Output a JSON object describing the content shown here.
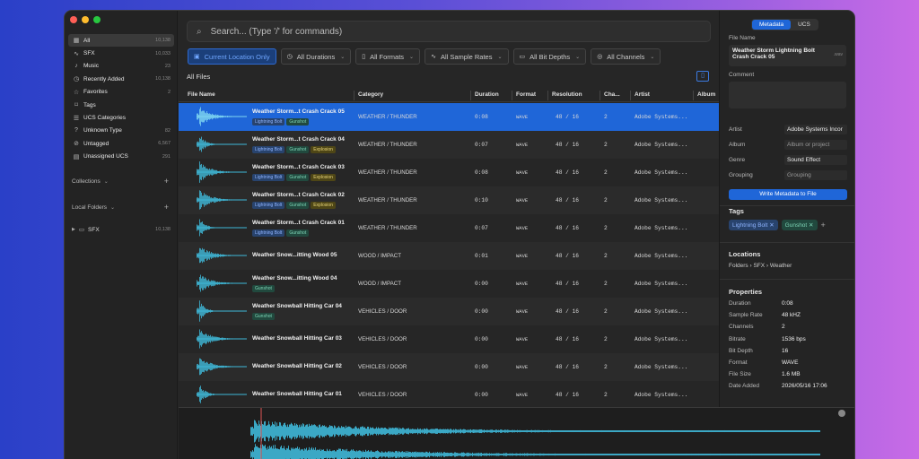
{
  "colors": {
    "accent": "#1f66d8",
    "waveform": "#3fb8d8"
  },
  "sidebar": {
    "items": [
      {
        "icon": "grid-icon",
        "label": "All",
        "count": "10,138",
        "active": true
      },
      {
        "icon": "waveform-icon",
        "label": "SFX",
        "count": "10,033"
      },
      {
        "icon": "music-note-icon",
        "label": "Music",
        "count": "23"
      },
      {
        "icon": "clock-icon",
        "label": "Recently Added",
        "count": "10,138"
      },
      {
        "icon": "star-icon",
        "label": "Favorites",
        "count": "2"
      },
      {
        "icon": "tag-icon",
        "label": "Tags",
        "count": ""
      },
      {
        "icon": "list-icon",
        "label": "UCS Categories",
        "count": ""
      },
      {
        "icon": "question-icon",
        "label": "Unknown Type",
        "count": "82"
      },
      {
        "icon": "untagged-icon",
        "label": "Untagged",
        "count": "6,567"
      },
      {
        "icon": "unassigned-icon",
        "label": "Unassigned UCS",
        "count": "291"
      }
    ],
    "collections_label": "Collections",
    "local_folders_label": "Local Folders",
    "folder": {
      "name": "SFX",
      "count": "10,138"
    }
  },
  "search": {
    "placeholder": "Search... (Type '/' for commands)"
  },
  "filters": [
    {
      "label": "Current Location Only",
      "active": true
    },
    {
      "label": "All Durations"
    },
    {
      "label": "All Formats"
    },
    {
      "label": "All Sample Rates"
    },
    {
      "label": "All Bit Depths"
    },
    {
      "label": "All Channels"
    }
  ],
  "list": {
    "title": "All Files",
    "columns": [
      "File Name",
      "Category",
      "Duration",
      "Format",
      "Resolution",
      "Cha...",
      "Artist",
      "Album"
    ],
    "rows": [
      {
        "name": "Weather Storm...t Crash Crack 05",
        "tags": [
          [
            "Lightning Bolt",
            "blue"
          ],
          [
            "Gunshot",
            "green"
          ]
        ],
        "category": "WEATHER / THUNDER",
        "duration": "0:08",
        "format": "WAVE",
        "resolution": "48 / 16",
        "channels": "2",
        "artist": "Adobe Systems..."
      },
      {
        "name": "Weather Storm...t Crash Crack 04",
        "tags": [
          [
            "Lightning Bolt",
            "blue"
          ],
          [
            "Gunshot",
            "green"
          ],
          [
            "Explosion",
            "yellow"
          ]
        ],
        "category": "WEATHER / THUNDER",
        "duration": "0:07",
        "format": "WAVE",
        "resolution": "48 / 16",
        "channels": "2",
        "artist": "Adobe Systems..."
      },
      {
        "name": "Weather Storm...t Crash Crack 03",
        "tags": [
          [
            "Lightning Bolt",
            "blue"
          ],
          [
            "Gunshot",
            "green"
          ],
          [
            "Explosion",
            "yellow"
          ]
        ],
        "category": "WEATHER / THUNDER",
        "duration": "0:08",
        "format": "WAVE",
        "resolution": "48 / 16",
        "channels": "2",
        "artist": "Adobe Systems..."
      },
      {
        "name": "Weather Storm...t Crash Crack 02",
        "tags": [
          [
            "Lightning Bolt",
            "blue"
          ],
          [
            "Gunshot",
            "green"
          ],
          [
            "Explosion",
            "yellow"
          ]
        ],
        "category": "WEATHER / THUNDER",
        "duration": "0:10",
        "format": "WAVE",
        "resolution": "48 / 16",
        "channels": "2",
        "artist": "Adobe Systems..."
      },
      {
        "name": "Weather Storm...t Crash Crack 01",
        "tags": [
          [
            "Lightning Bolt",
            "blue"
          ],
          [
            "Gunshot",
            "green"
          ]
        ],
        "category": "WEATHER / THUNDER",
        "duration": "0:07",
        "format": "WAVE",
        "resolution": "48 / 16",
        "channels": "2",
        "artist": "Adobe Systems..."
      },
      {
        "name": "Weather Snow...itting Wood 05",
        "tags": [],
        "category": "WOOD / IMPACT",
        "duration": "0:01",
        "format": "WAVE",
        "resolution": "48 / 16",
        "channels": "2",
        "artist": "Adobe Systems..."
      },
      {
        "name": "Weather Snow...itting Wood 04",
        "tags": [
          [
            "Gunshot",
            "green"
          ]
        ],
        "category": "WOOD / IMPACT",
        "duration": "0:00",
        "format": "WAVE",
        "resolution": "48 / 16",
        "channels": "2",
        "artist": "Adobe Systems..."
      },
      {
        "name": "Weather Snowball Hitting Car 04",
        "tags": [
          [
            "Gunshot",
            "green"
          ]
        ],
        "category": "VEHICLES / DOOR",
        "duration": "0:00",
        "format": "WAVE",
        "resolution": "48 / 16",
        "channels": "2",
        "artist": "Adobe Systems..."
      },
      {
        "name": "Weather Snowball Hitting Car 03",
        "tags": [],
        "category": "VEHICLES / DOOR",
        "duration": "0:00",
        "format": "WAVE",
        "resolution": "48 / 16",
        "channels": "2",
        "artist": "Adobe Systems..."
      },
      {
        "name": "Weather Snowball Hitting Car 02",
        "tags": [],
        "category": "VEHICLES / DOOR",
        "duration": "0:00",
        "format": "WAVE",
        "resolution": "48 / 16",
        "channels": "2",
        "artist": "Adobe Systems..."
      },
      {
        "name": "Weather Snowball Hitting Car 01",
        "tags": [],
        "category": "VEHICLES / DOOR",
        "duration": "0:00",
        "format": "WAVE",
        "resolution": "48 / 16",
        "channels": "2",
        "artist": "Adobe Systems..."
      }
    ]
  },
  "panel": {
    "tabs": [
      "Metadata",
      "UCS"
    ],
    "file_name_label": "File Name",
    "file_name": "Weather Storm Lightning Bolt Crash Crack 05",
    "file_ext": ".wav",
    "comment_label": "Comment",
    "fields": [
      {
        "key": "Artist",
        "value": "Adobe Systems Incor",
        "placeholder": false
      },
      {
        "key": "Album",
        "value": "Album or project",
        "placeholder": true
      },
      {
        "key": "Genre",
        "value": "Sound Effect",
        "placeholder": false
      },
      {
        "key": "Grouping",
        "value": "Grouping",
        "placeholder": true
      }
    ],
    "write_button": "Write Metadata to File",
    "tags_label": "Tags",
    "tags": [
      [
        "Lightning Bolt",
        "blue"
      ],
      [
        "Gunshot",
        "green"
      ]
    ],
    "locations_label": "Locations",
    "location_path": "Folders › SFX › Weather",
    "properties_label": "Properties",
    "properties": [
      {
        "key": "Duration",
        "value": "0:08"
      },
      {
        "key": "Sample Rate",
        "value": "48 kHZ"
      },
      {
        "key": "Channels",
        "value": "2"
      },
      {
        "key": "Bitrate",
        "value": "1536 bps"
      },
      {
        "key": "Bit Depth",
        "value": "16"
      },
      {
        "key": "Format",
        "value": "WAVE"
      },
      {
        "key": "File Size",
        "value": "1.6 MB"
      },
      {
        "key": "Date Added",
        "value": "2026/05/16 17:06"
      }
    ]
  }
}
